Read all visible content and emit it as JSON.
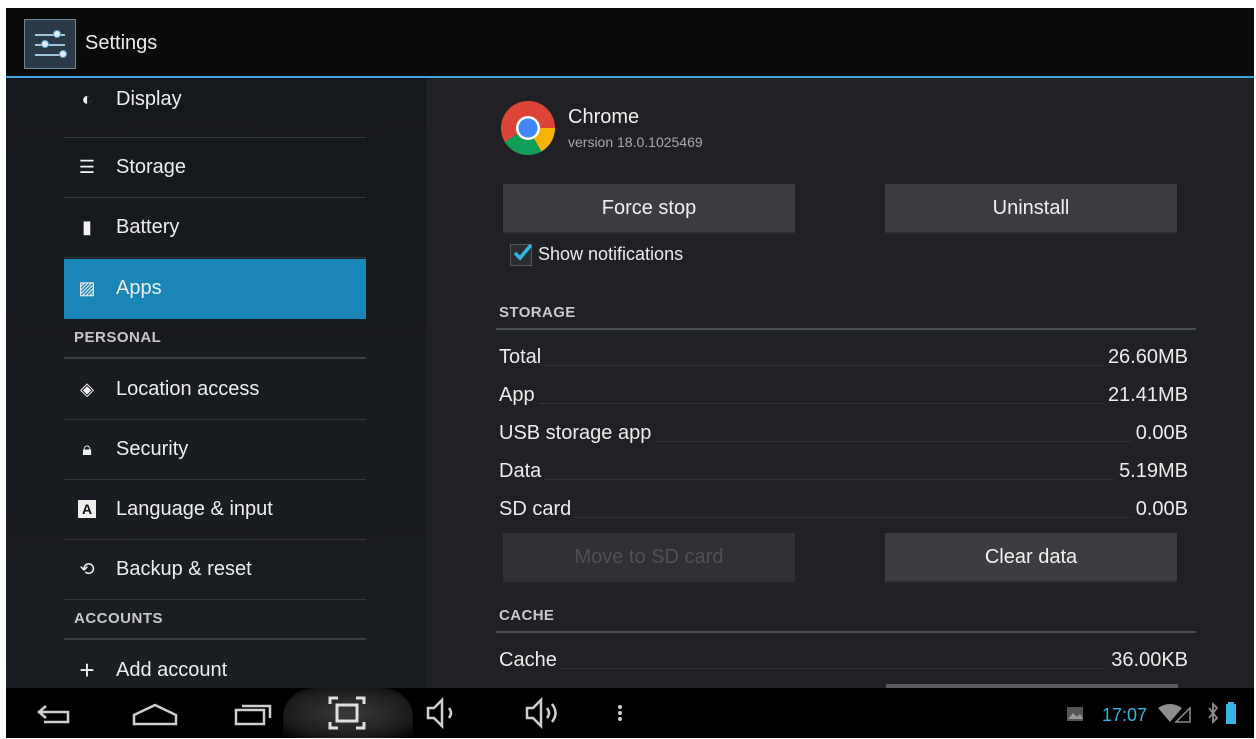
{
  "action_bar": {
    "title": "Settings"
  },
  "sidebar": {
    "items_top": [
      {
        "label": "Display",
        "icon": "display-icon"
      },
      {
        "label": "Storage",
        "icon": "storage-icon"
      },
      {
        "label": "Battery",
        "icon": "battery-icon"
      },
      {
        "label": "Apps",
        "icon": "apps-icon",
        "active": true
      }
    ],
    "personal_header": "PERSONAL",
    "items_personal": [
      {
        "label": "Location access",
        "icon": "location-icon"
      },
      {
        "label": "Security",
        "icon": "lock-icon"
      },
      {
        "label": "Language & input",
        "icon": "keyboard-icon"
      },
      {
        "label": "Backup & reset",
        "icon": "backup-icon"
      }
    ],
    "accounts_header": "ACCOUNTS",
    "add_account": {
      "label": "Add account",
      "icon": "plus-icon"
    }
  },
  "app_info": {
    "name": "Chrome",
    "version": "version 18.0.1025469",
    "force_stop": "Force stop",
    "uninstall": "Uninstall",
    "show_notifications": "Show notifications",
    "show_notifications_checked": true,
    "storage_header": "STORAGE",
    "storage_rows": [
      {
        "label": "Total",
        "value": "26.60MB"
      },
      {
        "label": "App",
        "value": "21.41MB"
      },
      {
        "label": "USB storage app",
        "value": "0.00B"
      },
      {
        "label": "Data",
        "value": "5.19MB"
      },
      {
        "label": "SD card",
        "value": "0.00B"
      }
    ],
    "move_to_sd": "Move to SD card",
    "move_to_sd_enabled": false,
    "clear_data": "Clear data",
    "cache_header": "CACHE",
    "cache_rows": [
      {
        "label": "Cache",
        "value": "36.00KB"
      }
    ]
  },
  "system_bar": {
    "time": "17:07",
    "accent": "#33b5e5"
  }
}
